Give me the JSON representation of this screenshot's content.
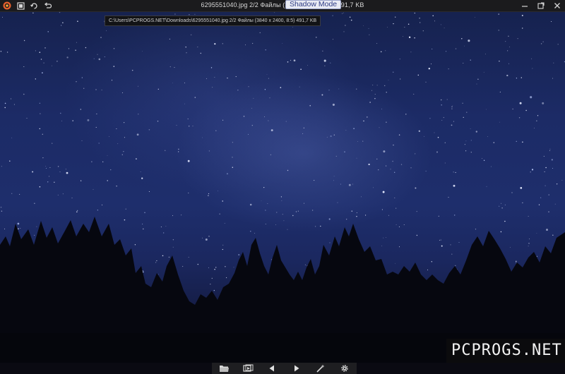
{
  "window": {
    "title": "6295551040.jpg 2/2 Файлы (3840 x 2400, 8:5) 491,7 KB"
  },
  "tooltips": {
    "shadow_mode": "Shadow Mode",
    "file_path": "C:\\Users\\PCPROGS.NET\\Downloads\\6295551040.jpg 2/2 Файлы (3840 x 2400, 8:5) 491,7 KB"
  },
  "titlebar_icons": [
    "app-logo-icon",
    "gallery-icon",
    "rotate-icon",
    "undo-icon"
  ],
  "window_controls": [
    "minimize-icon",
    "maximize-icon",
    "close-icon"
  ],
  "bottom_toolbar": [
    "open-folder-icon",
    "slideshow-icon",
    "previous-icon",
    "next-icon",
    "magic-wand-icon",
    "settings-icon"
  ],
  "watermark": "PCPROGS.NET",
  "colors": {
    "titlebar_bg": "#1b1b1d",
    "app_logo": "#e8602c",
    "tooltip_bg": "#e9ebf3",
    "tooltip_text": "#2d3b84",
    "sky_mid": "#1e2e6c"
  }
}
